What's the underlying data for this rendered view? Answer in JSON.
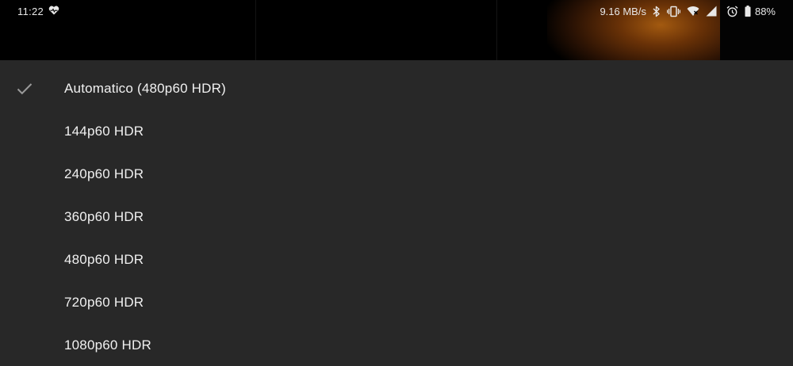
{
  "status_bar": {
    "time": "11:22",
    "left_icon": "heart-pulse-icon",
    "network_speed": "9.16 MB/s",
    "icons": [
      "bluetooth-icon",
      "vibrate-icon",
      "wifi-icon",
      "cell-signal-icon",
      "alarm-icon",
      "battery-icon"
    ],
    "battery_percent": "88%"
  },
  "quality_menu": {
    "selected_index": 0,
    "items": [
      {
        "label": "Automatico (480p60 HDR)",
        "selected": true
      },
      {
        "label": "144p60 HDR",
        "selected": false
      },
      {
        "label": "240p60 HDR",
        "selected": false
      },
      {
        "label": "360p60 HDR",
        "selected": false
      },
      {
        "label": "480p60 HDR",
        "selected": false
      },
      {
        "label": "720p60 HDR",
        "selected": false
      },
      {
        "label": "1080p60 HDR",
        "selected": false
      }
    ]
  },
  "colors": {
    "sheet_background": "#282828",
    "text": "#f1f1f1",
    "checkmark": "#9a9a9a",
    "status_bar_background": "#000000"
  }
}
